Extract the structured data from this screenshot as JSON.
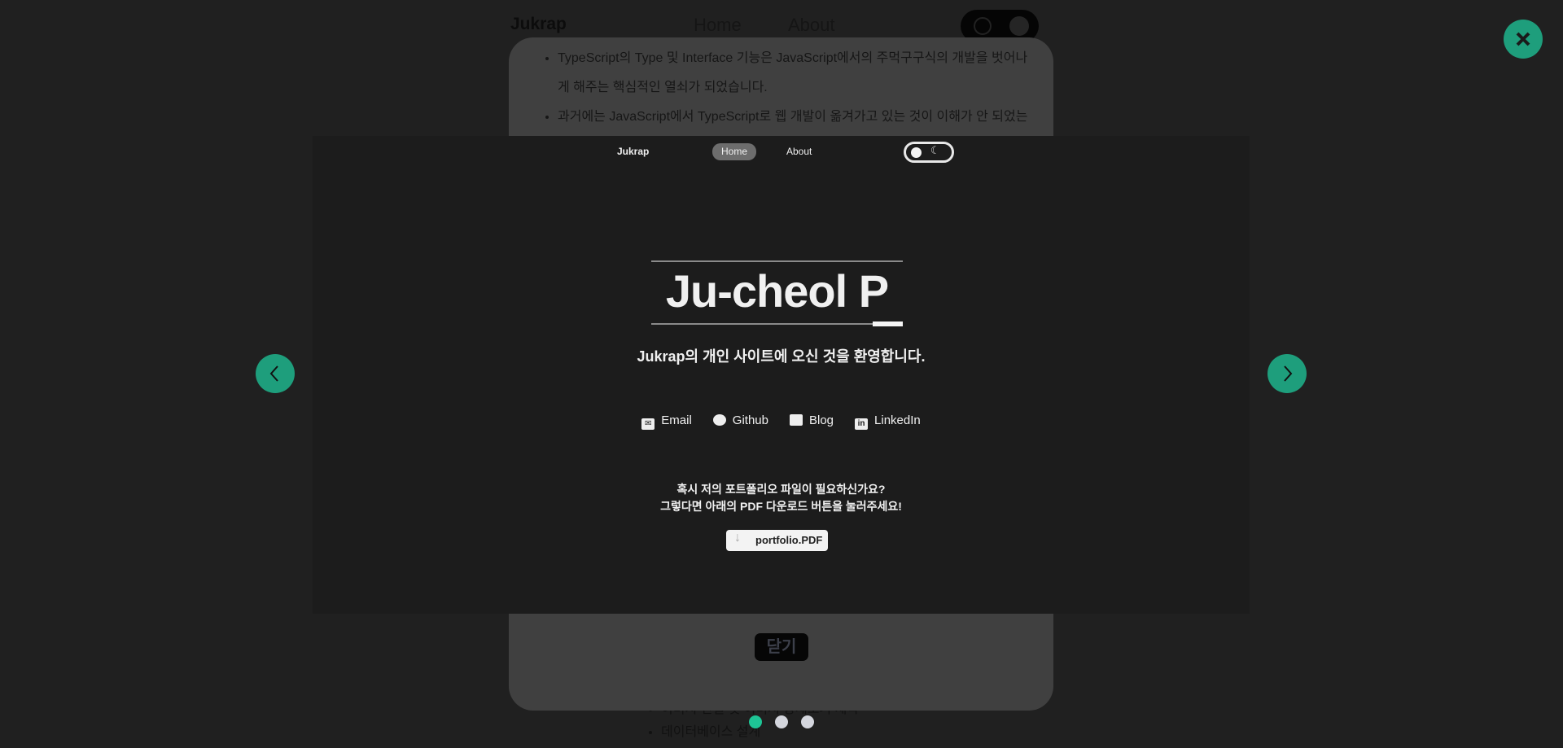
{
  "background_page": {
    "brand": "Jukrap",
    "nav": [
      "Home",
      "About"
    ],
    "content_bullets": [
      "TypeScript의 Type 및 Interface 기능은 JavaScript에서의 주먹구구식의 개발을 벗어나게 해주는 핵심적인 열쇠가 되었습니다.",
      "과거에는 JavaScript에서 TypeScript로 웹 개발이 옮겨가고 있는 것이 이해가 안 되었는"
    ],
    "lower_bullets": [
      "이미지 연결 및 이미지 상세보기 제작",
      "데이터베이스 설계"
    ]
  },
  "modal": {
    "close_label": "닫기",
    "slides_total": 3,
    "active_slide": 1
  },
  "screenshot": {
    "brand": "Jukrap",
    "nav": [
      "Home",
      "About"
    ],
    "title": "Ju-cheol P",
    "subtitle": "Jukrap의 개인 사이트에 오신 것을 환영합니다.",
    "links": [
      {
        "icon": "email-icon",
        "label": "Email"
      },
      {
        "icon": "github-icon",
        "label": "Github"
      },
      {
        "icon": "blog-icon",
        "label": "Blog"
      },
      {
        "icon": "linkedin-icon",
        "label": "LinkedIn"
      }
    ],
    "question_line1": "혹시 저의 포트폴리오 파일이 필요하신가요?",
    "question_line2": "그렇다면 아래의 PDF 다운로드 버튼을 눌러주세요!",
    "pdf_button": "portfolio.PDF"
  },
  "colors": {
    "accent": "#1e9e7c",
    "dot_inactive": "#d4d6dd"
  }
}
